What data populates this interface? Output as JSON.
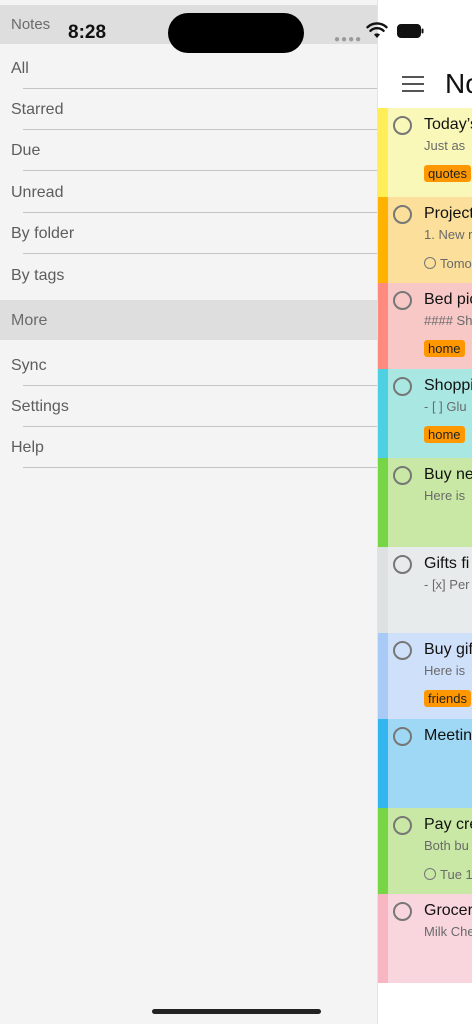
{
  "status": {
    "time": "8:28"
  },
  "drawer": {
    "header": "Notes",
    "main_items": [
      {
        "label": "All"
      },
      {
        "label": "Starred"
      },
      {
        "label": "Due"
      },
      {
        "label": "Unread"
      },
      {
        "label": "By folder"
      },
      {
        "label": "By tags"
      }
    ],
    "section": "More",
    "more_items": [
      {
        "label": "Sync"
      },
      {
        "label": "Settings"
      },
      {
        "label": "Help"
      }
    ]
  },
  "notes_panel": {
    "title": "No",
    "notes": [
      {
        "title": "Today’s",
        "snippet": "Just as",
        "tag": "quotes",
        "reminder": "",
        "color_bg": "#f9f8b9",
        "color_stripe": "#ffee58"
      },
      {
        "title": "Project",
        "snippet": "1. New r",
        "tag": "",
        "reminder": "Tomo",
        "color_bg": "#fbdf9a",
        "color_stripe": "#ffb300"
      },
      {
        "title": "Bed pic",
        "snippet": "#### Sh",
        "tag": "home",
        "reminder": "",
        "color_bg": "#f7c8c6",
        "color_stripe": "#ff8a80"
      },
      {
        "title": "Shoppi",
        "snippet": "- [ ] Glu",
        "tag": "home",
        "reminder": "",
        "color_bg": "#a9e7e2",
        "color_stripe": "#4dd0e1"
      },
      {
        "title": "Buy ne",
        "snippet": "Here is",
        "tag": "",
        "reminder": "",
        "color_bg": "#c9e8a5",
        "color_stripe": "#76d645"
      },
      {
        "title": "Gifts fi",
        "snippet": "- [x] Per",
        "tag": "",
        "reminder": "",
        "color_bg": "#e8ebec",
        "color_stripe": "#dde1e2"
      },
      {
        "title": "Buy gif",
        "snippet": "Here is",
        "tag": "friends",
        "reminder": "",
        "color_bg": "#cfe1fa",
        "color_stripe": "#a9c9f7"
      },
      {
        "title": "Meetin",
        "snippet": "",
        "tag": "",
        "reminder": "",
        "color_bg": "#9fd8f4",
        "color_stripe": "#33b5f0"
      },
      {
        "title": "Pay cre",
        "snippet": "Both bu",
        "tag": "",
        "reminder": "Tue 1",
        "color_bg": "#c9e8a5",
        "color_stripe": "#76d645"
      },
      {
        "title": "Grocer",
        "snippet": "Milk Che",
        "tag": "",
        "reminder": "",
        "color_bg": "#f9d6dd",
        "color_stripe": "#f7b6c1"
      }
    ]
  }
}
